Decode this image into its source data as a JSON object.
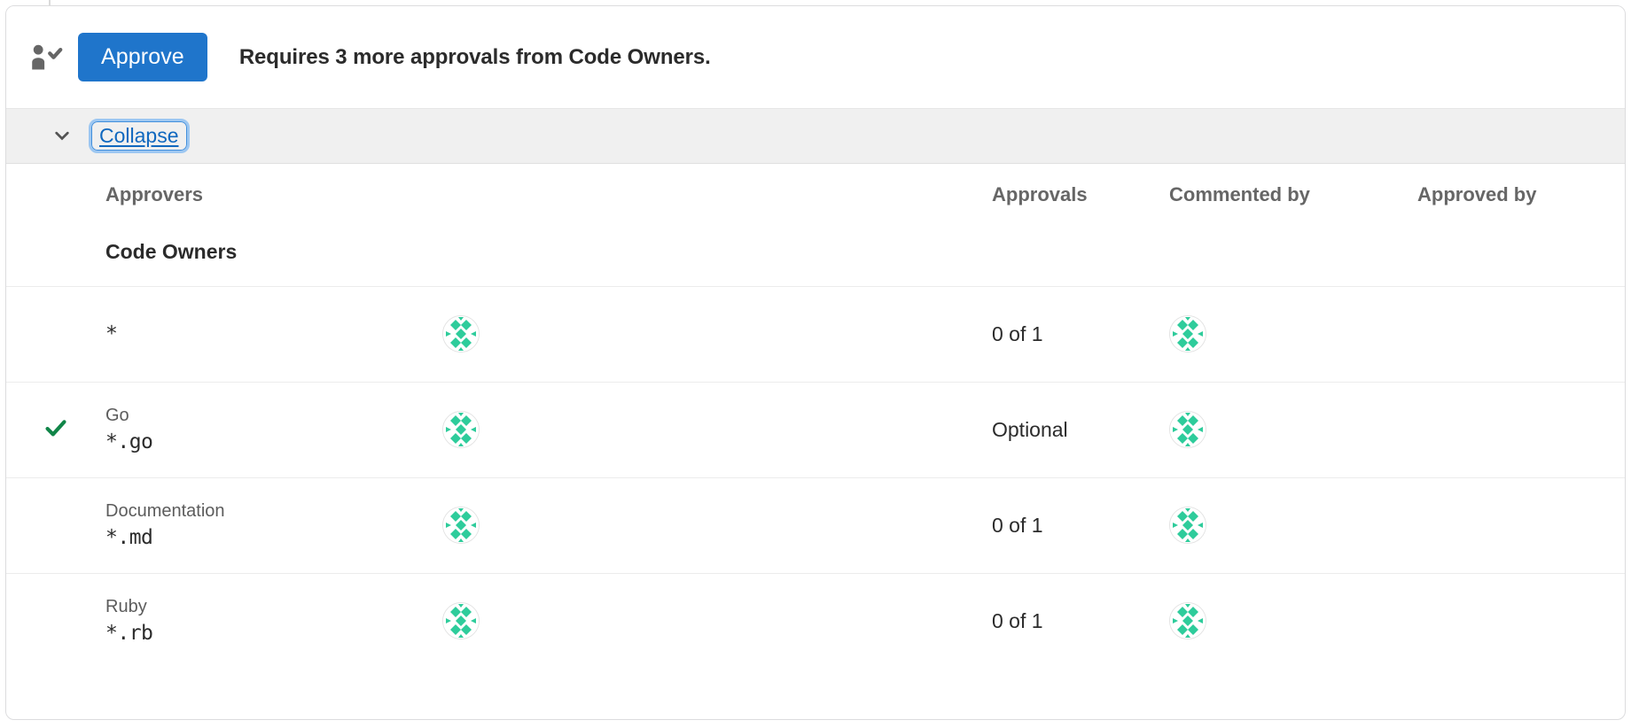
{
  "widget": {
    "header": {
      "icon": "user-check-icon",
      "approve_label": "Approve",
      "message": "Requires 3 more approvals from Code Owners."
    },
    "collapse_bar": {
      "chevron_icon": "chevron-down-icon",
      "collapse_label": "Collapse"
    },
    "table": {
      "columns": [
        {
          "key": "check",
          "label": ""
        },
        {
          "key": "approvers",
          "label": "Approvers"
        },
        {
          "key": "avatars",
          "label": ""
        },
        {
          "key": "approvals",
          "label": "Approvals"
        },
        {
          "key": "commented_by",
          "label": "Commented by"
        },
        {
          "key": "approved_by",
          "label": "Approved by"
        }
      ],
      "section_title": "Code Owners",
      "rows": [
        {
          "approved": false,
          "check_icon": "",
          "name": "",
          "pattern": "*",
          "approver_avatar": "identicon-avatar",
          "approvals": "0 of 1",
          "commented_by_avatar": "identicon-avatar",
          "approved_by": ""
        },
        {
          "approved": true,
          "check_icon": "check-icon",
          "name": "Go",
          "pattern": "*.go",
          "approver_avatar": "identicon-avatar",
          "approvals": "Optional",
          "commented_by_avatar": "identicon-avatar",
          "approved_by": ""
        },
        {
          "approved": false,
          "check_icon": "",
          "name": "Documentation",
          "pattern": "*.md",
          "approver_avatar": "identicon-avatar",
          "approvals": "0 of 1",
          "commented_by_avatar": "identicon-avatar",
          "approved_by": ""
        },
        {
          "approved": false,
          "check_icon": "",
          "name": "Ruby",
          "pattern": "*.rb",
          "approver_avatar": "identicon-avatar",
          "approvals": "0 of 1",
          "commented_by_avatar": "identicon-avatar",
          "approved_by": ""
        }
      ]
    }
  },
  "colors": {
    "accent_blue": "#1f75cb",
    "link_blue": "#1068bf",
    "focus_ring": "#9dc7f1",
    "check_green": "#108548",
    "identicon_green": "#2ecc9b",
    "bar_gray": "#f0f0f0",
    "border_gray": "#dcdcde",
    "text_dark": "#2b2b2b",
    "text_muted": "#666666"
  }
}
